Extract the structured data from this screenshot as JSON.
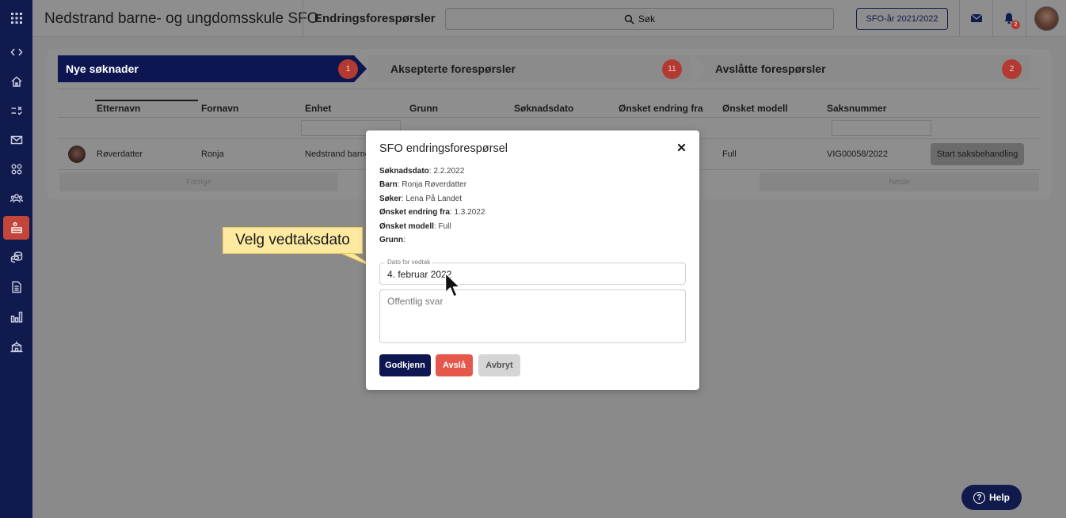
{
  "app": {
    "school_name": "Nedstrand barne- og ungdomsskule SFO",
    "page_title": "Endringsforespørsler",
    "search_placeholder": "Søk",
    "year_button": "SFO-år 2021/2022",
    "notification_count": "2"
  },
  "sidebar": {
    "items": [
      {
        "name": "apps-grid-icon"
      },
      {
        "name": "collapse-toggle-icon"
      },
      {
        "name": "home-icon"
      },
      {
        "name": "tasks-icon"
      },
      {
        "name": "mail-icon"
      },
      {
        "name": "groups-icon"
      },
      {
        "name": "people-icon"
      },
      {
        "name": "sfo-icon",
        "active": true
      },
      {
        "name": "payments-icon"
      },
      {
        "name": "document-icon"
      },
      {
        "name": "reports-icon"
      },
      {
        "name": "school-icon"
      }
    ]
  },
  "steps": [
    {
      "label": "Nye søknader",
      "count": "1"
    },
    {
      "label": "Aksepterte forespørsler",
      "count": "11"
    },
    {
      "label": "Avslåtte forespørsler",
      "count": "2"
    }
  ],
  "table": {
    "columns": [
      "Etternavn",
      "Fornavn",
      "Enhet",
      "Grunn",
      "Søknadsdato",
      "Ønsket endring fra",
      "Ønsket modell",
      "Saksnummer"
    ],
    "row": {
      "etternavn": "Røverdatter",
      "fornavn": "Ronja",
      "enhet": "Nedstrand barne-",
      "modell": "Full",
      "saksnummer": "VIG00058/2022",
      "action": "Start saksbehandling"
    },
    "prev": "Forrige",
    "next": "Neste"
  },
  "modal": {
    "title": "SFO endringsforespørsel",
    "fields": [
      {
        "label": "Søknadsdato",
        "value": ": 2.2.2022"
      },
      {
        "label": "Barn",
        "value": ": Ronja Røverdatter"
      },
      {
        "label": "Søker",
        "value": ": Lena På Landet"
      },
      {
        "label": "Ønsket endring fra",
        "value": ": 1.3.2022"
      },
      {
        "label": "Ønsket modell",
        "value": ": Full"
      },
      {
        "label": "Grunn",
        "value": ":"
      }
    ],
    "date_label": "Dato for vedtak",
    "date_value": "4. februar 2022",
    "reply_placeholder": "Offentlig svar",
    "approve": "Godkjenn",
    "reject": "Avslå",
    "cancel": "Avbryt"
  },
  "callout": "Velg vedtaksdato",
  "help": "Help",
  "colors": {
    "nav": "#101a4d",
    "accent_red": "#b23a30",
    "reject": "#e5574b"
  }
}
